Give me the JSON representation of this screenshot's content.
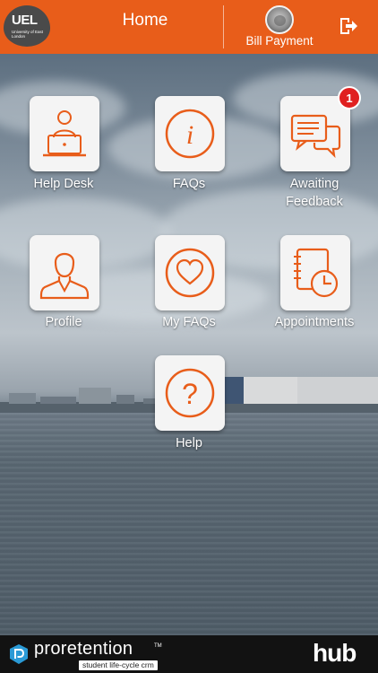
{
  "header": {
    "logo_main": "UEL",
    "logo_sub": "University of East London",
    "title": "Home",
    "bill_payment_label": "Bill Payment"
  },
  "tiles": [
    {
      "label": "Help Desk",
      "icon": "computer-user-icon"
    },
    {
      "label": "FAQs",
      "icon": "info-icon"
    },
    {
      "label": "Awaiting\nFeedback",
      "icon": "chat-bubbles-icon",
      "badge": "1"
    },
    {
      "label": "Profile",
      "icon": "person-icon"
    },
    {
      "label": "My FAQs",
      "icon": "heart-icon"
    },
    {
      "label": "Appointments",
      "icon": "calendar-clock-icon"
    },
    {
      "label": "Help",
      "icon": "question-icon"
    }
  ],
  "footer": {
    "brand": "proretention",
    "trademark": "TM",
    "tagline": "student life-cycle crm",
    "hub": "hub"
  },
  "colors": {
    "accent": "#e85d1a",
    "tile_bg": "#f4f4f4",
    "badge": "#e02020",
    "footer_bg": "#121212"
  }
}
